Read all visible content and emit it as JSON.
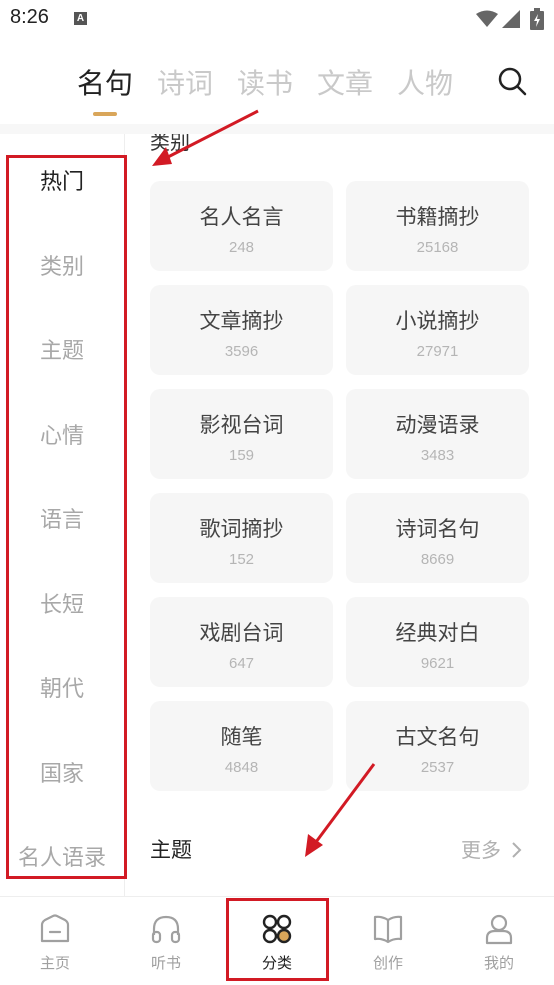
{
  "status_bar": {
    "time": "8:26",
    "notification_icon": "A"
  },
  "top_tabs": [
    "名句",
    "诗词",
    "读书",
    "文章",
    "人物"
  ],
  "active_tab_index": 0,
  "sidebar": {
    "items": [
      "热门",
      "类别",
      "主题",
      "心情",
      "语言",
      "长短",
      "朝代",
      "国家",
      "名人语录"
    ],
    "active_index": 0
  },
  "content": {
    "partial_header": "类别",
    "cards": [
      {
        "name": "名人名言",
        "count": "248"
      },
      {
        "name": "书籍摘抄",
        "count": "25168"
      },
      {
        "name": "文章摘抄",
        "count": "3596"
      },
      {
        "name": "小说摘抄",
        "count": "27971"
      },
      {
        "name": "影视台词",
        "count": "159"
      },
      {
        "name": "动漫语录",
        "count": "3483"
      },
      {
        "name": "歌词摘抄",
        "count": "152"
      },
      {
        "name": "诗词名句",
        "count": "8669"
      },
      {
        "name": "戏剧台词",
        "count": "647"
      },
      {
        "name": "经典对白",
        "count": "9621"
      },
      {
        "name": "随笔",
        "count": "4848"
      },
      {
        "name": "古文名句",
        "count": "2537"
      }
    ],
    "next_section_title": "主题",
    "more_label": "更多"
  },
  "bottom_nav": {
    "items": [
      {
        "label": "主页",
        "icon": "home-icon"
      },
      {
        "label": "听书",
        "icon": "headphones-icon"
      },
      {
        "label": "分类",
        "icon": "category-grid-icon"
      },
      {
        "label": "创作",
        "icon": "book-icon"
      },
      {
        "label": "我的",
        "icon": "person-icon"
      }
    ],
    "active_index": 2
  },
  "colors": {
    "accent": "#d9a65a",
    "annotation_red": "#d21a24",
    "card_bg": "#f6f6f6",
    "inactive_text": "#a8a8a8"
  }
}
